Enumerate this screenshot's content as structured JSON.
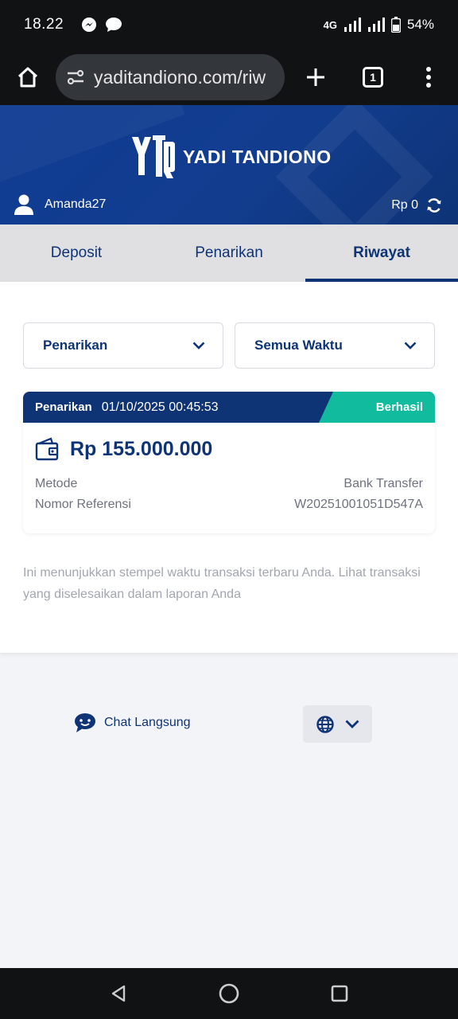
{
  "status_bar": {
    "time": "18.22",
    "network": "4G",
    "battery": "54%"
  },
  "browser": {
    "url": "yaditandiono.com/riw",
    "tab_count": "1"
  },
  "header": {
    "logo_text": "YADI TANDIONO",
    "username": "Amanda27",
    "balance": "Rp 0"
  },
  "tabs": [
    {
      "label": "Deposit",
      "active": false
    },
    {
      "label": "Penarikan",
      "active": false
    },
    {
      "label": "Riwayat",
      "active": true
    }
  ],
  "filters": {
    "type": "Penarikan",
    "time": "Semua Waktu"
  },
  "transaction": {
    "type": "Penarikan",
    "datetime": "01/10/2025 00:45:53",
    "status": "Berhasil",
    "amount": "Rp 155.000.000",
    "method_label": "Metode",
    "method_value": "Bank Transfer",
    "ref_label": "Nomor Referensi",
    "ref_value": "W20251001051D547A"
  },
  "note": "Ini menunjukkan stempel waktu transaksi terbaru Anda. Lihat transaksi yang diselesaikan dalam laporan Anda",
  "footer": {
    "chat_label": "Chat Langsung"
  },
  "colors": {
    "brand": "#0f3476",
    "success": "#11bb9d"
  },
  "icons": [
    "messenger-icon",
    "chat-bubble-icon",
    "signal-icon",
    "battery-icon",
    "home-icon",
    "site-settings-icon",
    "plus-icon",
    "tab-switcher-icon",
    "more-vert-icon",
    "user-icon",
    "refresh-icon",
    "chevron-down-icon",
    "wallet-icon",
    "live-chat-icon",
    "globe-icon",
    "back-icon",
    "home-circle-icon",
    "recents-icon"
  ]
}
